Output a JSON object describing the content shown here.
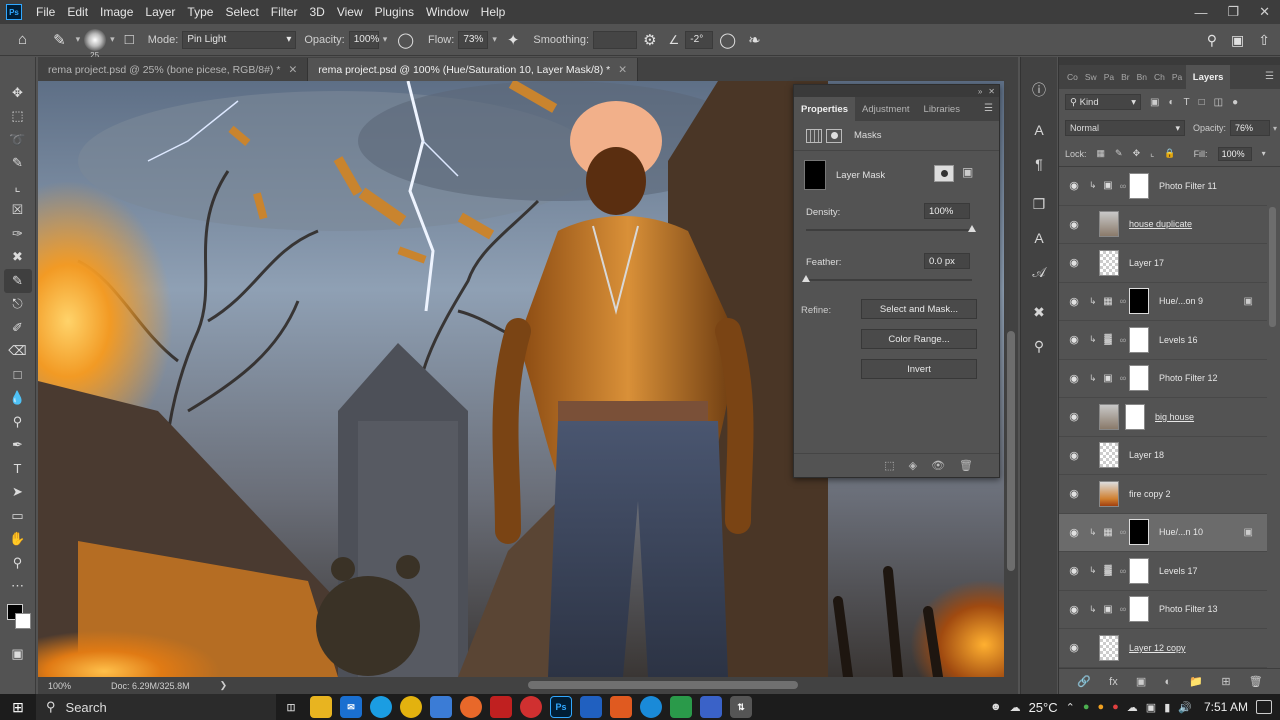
{
  "app": {
    "logo": "Ps",
    "menu": [
      "File",
      "Edit",
      "Image",
      "Layer",
      "Type",
      "Select",
      "Filter",
      "3D",
      "View",
      "Plugins",
      "Window",
      "Help"
    ]
  },
  "options": {
    "brush_size": "25",
    "mode_label": "Mode:",
    "mode_value": "Pin Light",
    "opacity_label": "Opacity:",
    "opacity_value": "100%",
    "flow_label": "Flow:",
    "flow_value": "73%",
    "smoothing_label": "Smoothing:",
    "smoothing_value": "",
    "angle_value": "-2°"
  },
  "tabs": [
    {
      "label": "rema project.psd @ 25% (bone picese, RGB/8#) *"
    },
    {
      "label": "rema project.psd @ 100% (Hue/Saturation 10, Layer Mask/8) *"
    }
  ],
  "status": {
    "zoom": "100%",
    "doc": "Doc: 6.29M/325.8M"
  },
  "properties": {
    "tabs": [
      "Properties",
      "Adjustment",
      "Libraries"
    ],
    "masks_label": "Masks",
    "layer_mask_label": "Layer Mask",
    "density_label": "Density:",
    "density_value": "100%",
    "density_level": 1.0,
    "feather_label": "Feather:",
    "feather_value": "0.0 px",
    "feather_level": 0.0,
    "refine_label": "Refine:",
    "select_mask_btn": "Select and Mask...",
    "color_range_btn": "Color Range...",
    "invert_btn": "Invert"
  },
  "layers_panel": {
    "tabs": [
      "Co",
      "Sw",
      "Pa",
      "Br",
      "Bn",
      "Ch",
      "Pa",
      "Layers"
    ],
    "kind_label": "Kind",
    "blend_mode": "Normal",
    "opacity_label": "Opacity:",
    "opacity_value": "76%",
    "lock_label": "Lock:",
    "fill_label": "Fill:",
    "fill_value": "100%",
    "layers": [
      {
        "name": "Photo Filter 11",
        "adj": "camera-icon",
        "thumb": "white",
        "clipped": true,
        "underline": false,
        "selected": false
      },
      {
        "name": "house duplicate",
        "adj": "",
        "thumb": "house",
        "clipped": false,
        "underline": true,
        "selected": false
      },
      {
        "name": "Layer 17",
        "adj": "",
        "thumb": "checker",
        "clipped": false,
        "underline": false,
        "selected": false
      },
      {
        "name": "Hue/...on 9",
        "adj": "hue-icon",
        "thumb": "black",
        "clipped": true,
        "underline": false,
        "selected": false
      },
      {
        "name": "Levels 16",
        "adj": "levels-icon",
        "thumb": "white",
        "clipped": true,
        "underline": false,
        "selected": false
      },
      {
        "name": "Photo Filter 12",
        "adj": "camera-icon",
        "thumb": "white",
        "clipped": true,
        "underline": false,
        "selected": false
      },
      {
        "name": "big house",
        "adj": "",
        "thumb": "house",
        "clipped": false,
        "underline": true,
        "selected": false
      },
      {
        "name": "Layer 18",
        "adj": "",
        "thumb": "checker",
        "clipped": false,
        "underline": false,
        "selected": false
      },
      {
        "name": "fire copy 2",
        "adj": "",
        "thumb": "fire",
        "clipped": false,
        "underline": false,
        "selected": false
      },
      {
        "name": "Hue/...n 10",
        "adj": "hue-icon",
        "thumb": "black",
        "clipped": true,
        "underline": false,
        "selected": true
      },
      {
        "name": "Levels 17",
        "adj": "levels-icon",
        "thumb": "white",
        "clipped": true,
        "underline": false,
        "selected": false
      },
      {
        "name": "Photo Filter 13",
        "adj": "camera-icon",
        "thumb": "white",
        "clipped": true,
        "underline": false,
        "selected": false
      },
      {
        "name": "Layer 12 copy",
        "adj": "",
        "thumb": "checker",
        "clipped": false,
        "underline": true,
        "selected": false
      }
    ]
  },
  "taskbar": {
    "search_label": "Search",
    "temperature": "25°C",
    "time": "7:51 AM"
  },
  "colors": {
    "panel": "#535353",
    "dark": "#3d3d3d",
    "ps_blue": "#31a8ff"
  }
}
